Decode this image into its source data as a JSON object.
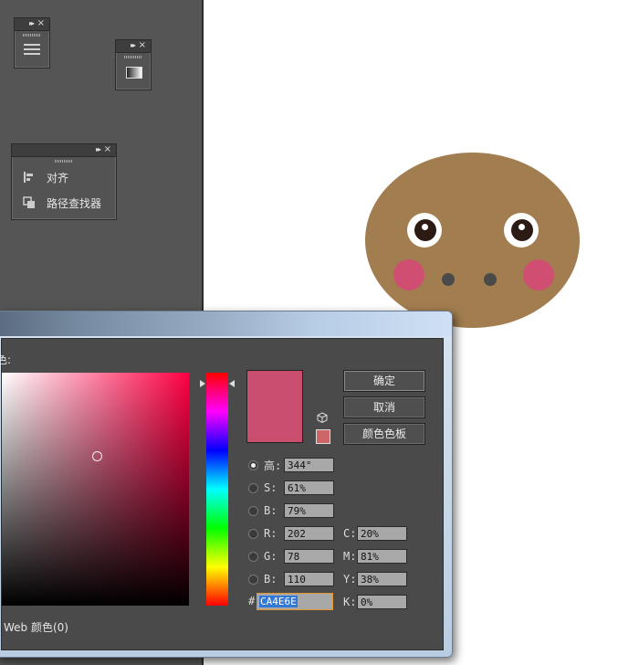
{
  "workspace": {
    "panels": {
      "align_panel": {
        "items": [
          {
            "label": "对齐",
            "icon": "align-icon"
          },
          {
            "label": "路径查找器",
            "icon": "pathfinder-icon"
          }
        ]
      }
    }
  },
  "artboard": {
    "face_color": "#a27d4f",
    "cheek_color": "#d04e72"
  },
  "color_picker": {
    "select_color_label": "色:",
    "buttons": {
      "ok": "确定",
      "cancel": "取消",
      "swatches": "颜色色板"
    },
    "current_color": "#ca4e6e",
    "websafe_color": "#cc6666",
    "hsb": [
      {
        "label": "高:",
        "value": "344°",
        "selected": true
      },
      {
        "label": "S:",
        "value": "61%",
        "selected": false
      },
      {
        "label": "B:",
        "value": "79%",
        "selected": false
      }
    ],
    "rgb": [
      {
        "label": "R:",
        "value": "202"
      },
      {
        "label": "G:",
        "value": "78"
      },
      {
        "label": "B:",
        "value": "110"
      }
    ],
    "cmyk": [
      {
        "label": "C:",
        "value": "20%"
      },
      {
        "label": "M:",
        "value": "81%"
      },
      {
        "label": "Y:",
        "value": "38%"
      },
      {
        "label": "K:",
        "value": "0%"
      }
    ],
    "hex_prefix": "#",
    "hex_value": "CA4E6E",
    "web_only_label": "Web 颜色(0)"
  }
}
